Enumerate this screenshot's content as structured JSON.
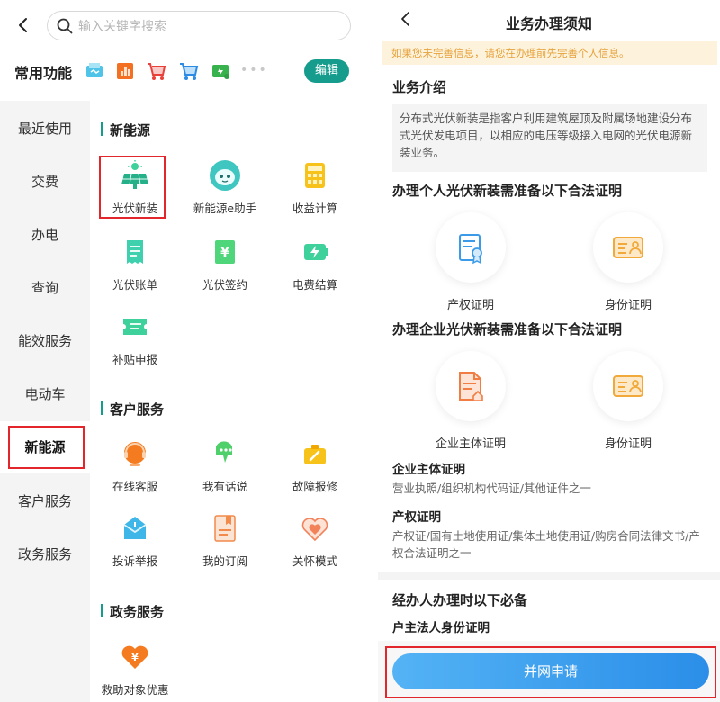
{
  "left": {
    "search": {
      "placeholder": "输入关键字搜索"
    },
    "common": {
      "title": "常用功能",
      "more": "•••",
      "edit_label": "编辑",
      "icons": [
        "bill-icon",
        "chart-icon",
        "cart-icon",
        "shopping-cart-icon",
        "payment-icon"
      ]
    },
    "nav": [
      {
        "label": "最近使用"
      },
      {
        "label": "交费"
      },
      {
        "label": "办电"
      },
      {
        "label": "查询"
      },
      {
        "label": "能效服务"
      },
      {
        "label": "电动车"
      },
      {
        "label": "新能源",
        "active": true
      },
      {
        "label": "客户服务"
      },
      {
        "label": "政务服务"
      }
    ],
    "sections": {
      "new_energy": {
        "title": "新能源",
        "items": [
          {
            "label": "光伏新装",
            "icon": "solar-panel-icon"
          },
          {
            "label": "新能源e助手",
            "icon": "robot-assistant-icon"
          },
          {
            "label": "收益计算",
            "icon": "calculator-icon"
          },
          {
            "label": "光伏账单",
            "icon": "bill-icon"
          },
          {
            "label": "光伏签约",
            "icon": "contract-icon"
          },
          {
            "label": "电费结算",
            "icon": "battery-settlement-icon"
          },
          {
            "label": "补贴申报",
            "icon": "ticket-icon"
          }
        ]
      },
      "customer_service": {
        "title": "客户服务",
        "items": [
          {
            "label": "在线客服",
            "icon": "headset-icon"
          },
          {
            "label": "我有话说",
            "icon": "speech-icon"
          },
          {
            "label": "故障报修",
            "icon": "repair-icon"
          },
          {
            "label": "投诉举报",
            "icon": "mail-icon"
          },
          {
            "label": "我的订阅",
            "icon": "bookmark-icon"
          },
          {
            "label": "关怀模式",
            "icon": "care-heart-icon"
          }
        ]
      },
      "gov_service": {
        "title": "政务服务",
        "items": [
          {
            "label": "救助对象优惠",
            "icon": "heart-yuan-icon"
          }
        ]
      }
    }
  },
  "right": {
    "title": "业务办理须知",
    "notice": "如果您未完善信息，请您在办理前先完善个人信息。",
    "intro": {
      "heading": "业务介绍",
      "text": "分布式光伏新装是指客户利用建筑屋顶及附属场地建设分布式光伏发电项目，以相应的电压等级接入电网的光伏电源新装业务。"
    },
    "personal": {
      "heading": "办理个人光伏新装需准备以下合法证明",
      "certs": [
        {
          "label": "产权证明",
          "icon": "property-certificate-icon"
        },
        {
          "label": "身份证明",
          "icon": "id-card-icon"
        }
      ]
    },
    "enterprise": {
      "heading": "办理企业光伏新装需准备以下合法证明",
      "certs": [
        {
          "label": "企业主体证明",
          "icon": "enterprise-document-icon"
        },
        {
          "label": "身份证明",
          "icon": "id-card-icon"
        }
      ]
    },
    "details": [
      {
        "title": "企业主体证明",
        "text": "营业执照/组织机构代码证/其他证件之一"
      },
      {
        "title": "产权证明",
        "text": "产权证/国有土地使用证/集体土地使用证/购房合同法律文书/产权合法证明之一"
      }
    ],
    "agent": {
      "heading": "经办人办理时以下必备",
      "sub": "户主法人身份证明"
    },
    "apply_label": "并网申请"
  },
  "colors": {
    "brand": "#159c8d",
    "highlight": "#e3262b",
    "notice_bg": "#fdf3dc",
    "notice_text": "#e6a23c",
    "apply_button": "#3a9bec"
  }
}
